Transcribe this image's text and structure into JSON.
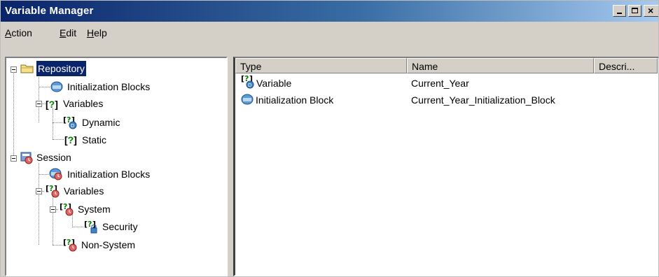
{
  "window": {
    "title": "Variable Manager"
  },
  "menu": {
    "action": {
      "underlined": "A",
      "rest": "ction"
    },
    "edit": {
      "underlined": "E",
      "rest": "dit"
    },
    "help": {
      "underlined": "H",
      "rest": "elp"
    }
  },
  "tree": {
    "repository": "Repository",
    "repo_init_blocks": "Initialization Blocks",
    "repo_variables": "Variables",
    "dynamic": "Dynamic",
    "static": "Static",
    "session": "Session",
    "session_init_blocks": "Initialization Blocks",
    "session_variables": "Variables",
    "system": "System",
    "security": "Security",
    "non_system": "Non-System"
  },
  "list": {
    "columns": [
      "Type",
      "Name",
      "Descri..."
    ],
    "rows": [
      {
        "type": "Variable",
        "name": "Current_Year"
      },
      {
        "type": "Initialization Block",
        "name": "Current_Year_Initialization_Block"
      }
    ]
  },
  "colors": {
    "selection": "#0a246a",
    "titlebar_start": "#0a246a",
    "titlebar_end": "#a6caf0",
    "chrome": "#d4d0c8"
  }
}
